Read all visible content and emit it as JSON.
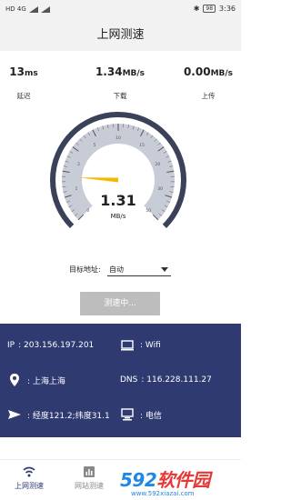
{
  "status_bar": {
    "carrier_icons": "HD 4G",
    "battery": "98",
    "time": "3:36"
  },
  "header": {
    "title": "上网测速"
  },
  "metrics": [
    {
      "value": "13",
      "unit": "ms",
      "label": "延迟"
    },
    {
      "value": "1.34",
      "unit": "MB/s",
      "label": "下载"
    },
    {
      "value": "0.00",
      "unit": "MB/s",
      "label": "上传"
    }
  ],
  "gauge": {
    "value": "1.31",
    "unit": "MB/s",
    "ticks": [
      "0",
      "1",
      "2",
      "5",
      "10",
      "15",
      "20",
      "30",
      "50"
    ],
    "needle_value_fraction": 0.18,
    "colors": {
      "arc": "#3a4158",
      "fill": "#c8ccd6",
      "needle": "#f5b800"
    }
  },
  "target": {
    "label": "目标地址:",
    "value": "自动"
  },
  "test_button": {
    "label": "测速中..."
  },
  "info": {
    "ip_label": "IP",
    "ip_value": ": 203.156.197.201",
    "network_value": ": Wifi",
    "location_value": ": 上海上海",
    "dns_label": "DNS",
    "dns_value": ": 116.228.111.27",
    "coords_value": ": 经度121.2;纬度31.1",
    "isp_value": ": 电信",
    "panel_color": "#2e3a70"
  },
  "nav": {
    "items": [
      {
        "label": "上网测速",
        "icon": "wifi-icon",
        "active": true
      },
      {
        "label": "网站测速",
        "icon": "bar-chart-icon",
        "active": false
      }
    ]
  },
  "watermark": {
    "main_prefix": "592",
    "main_suffix": "软件园",
    "url": "www.592xiazai.com"
  }
}
